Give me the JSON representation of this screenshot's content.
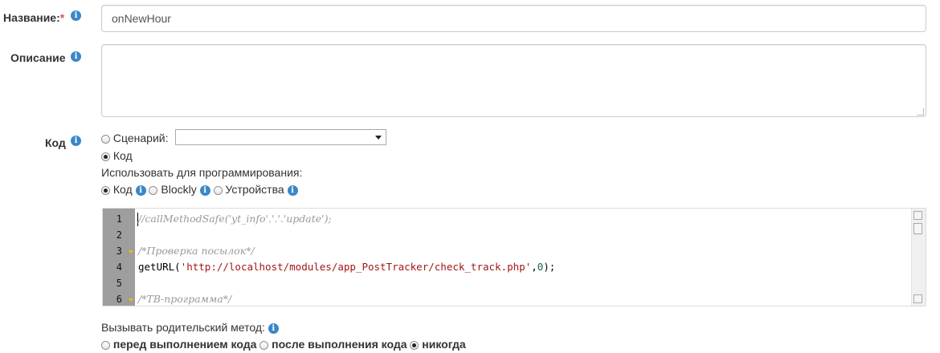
{
  "form": {
    "name_label": "Название:",
    "name_required": "*",
    "name_value": "onNewHour",
    "description_label": "Описание",
    "description_value": "",
    "code_label": "Код",
    "source_options": [
      {
        "label": "Сценарий:",
        "selected": false
      },
      {
        "label": "Код",
        "selected": true
      }
    ],
    "scenario_select_value": "",
    "use_for_programming_label": "Использовать для программирования:",
    "programming_options": [
      {
        "label": "Код",
        "selected": true
      },
      {
        "label": "Blockly",
        "selected": false
      },
      {
        "label": "Устройства",
        "selected": false
      }
    ],
    "code_lines": [
      {
        "n": "1",
        "text": "//callMethodSafe('yt_info'.'.'.'update');"
      },
      {
        "n": "2",
        "text": ""
      },
      {
        "n": "3",
        "text": "/*Проверка посылок*/"
      },
      {
        "n": "4",
        "text": "getURL('http://localhost/modules/app_PostTracker/check_track.php',0);"
      },
      {
        "n": "5",
        "text": ""
      },
      {
        "n": "6",
        "text": "/*ТВ-программа*/"
      }
    ],
    "call_parent_label": "Вызывать родительский метод:",
    "call_parent_options": [
      {
        "label": "перед выполнением кода",
        "selected": false
      },
      {
        "label": "после выполнения кода",
        "selected": false
      },
      {
        "label": "никогда",
        "selected": true
      }
    ]
  },
  "icons": {
    "info": "info-icon",
    "info_glyph": "i"
  },
  "colors": {
    "info_badge": "#3a87c8",
    "gutter": "#9e9e9e",
    "required": "#d9534f"
  }
}
